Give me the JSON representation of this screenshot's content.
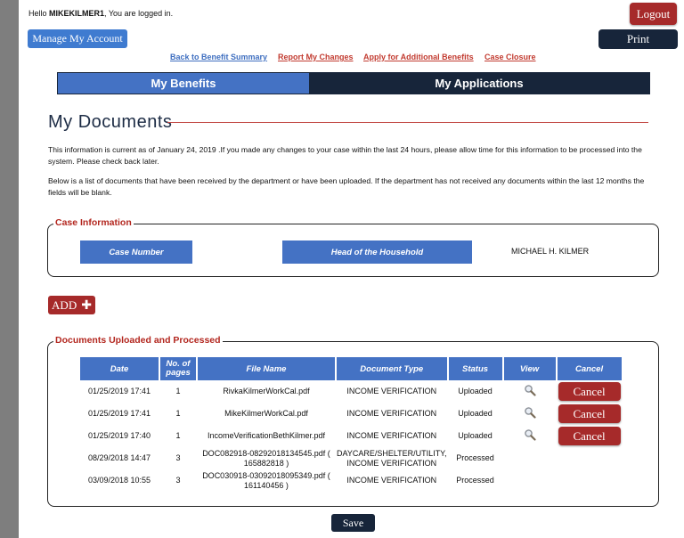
{
  "header": {
    "hello_prefix": "Hello ",
    "username": "MIKEKILMER1",
    "hello_suffix": ", You are logged in.",
    "logout_label": "Logout",
    "manage_account_label": "Manage My Account",
    "print_label": "Print"
  },
  "nav_links": [
    {
      "label": "Back to Benefit Summary",
      "color": "#3f6fc0"
    },
    {
      "label": "Report My Changes",
      "color": "#c23b30"
    },
    {
      "label": "Apply for Additional Benefits",
      "color": "#c23b30"
    },
    {
      "label": "Case Closure",
      "color": "#c23b30"
    }
  ],
  "tabs": [
    {
      "label": "My Benefits"
    },
    {
      "label": "My Applications"
    }
  ],
  "page_title": "My Documents",
  "info_paragraph_1": "This information is current as of January 24, 2019 .If you made any changes to your case within the last 24 hours, please allow time for this information to be processed into the system. Please check back later.",
  "info_paragraph_2": "Below is a list of documents that have been received by the department or have been uploaded. If the department has not received any documents within the last 12 months the fields will be blank.",
  "case_information": {
    "legend": "Case Information",
    "case_number_label": "Case Number",
    "head_of_household_label": "Head of the Household",
    "head_of_household_value": "MICHAEL H. KILMER"
  },
  "add_button_label": "ADD",
  "documents": {
    "legend": "Documents Uploaded and Processed",
    "columns": [
      "Date",
      "No. of pages",
      "File Name",
      "Document Type",
      "Status",
      "View",
      "Cancel"
    ],
    "rows": [
      {
        "date": "01/25/2019 17:41",
        "pages": "1",
        "file": "RivkaKilmerWorkCal.pdf",
        "type": "INCOME VERIFICATION",
        "status": "Uploaded",
        "viewable": true,
        "cancel": "Cancel"
      },
      {
        "date": "01/25/2019 17:41",
        "pages": "1",
        "file": "MikeKilmerWorkCal.pdf",
        "type": "INCOME VERIFICATION",
        "status": "Uploaded",
        "viewable": true,
        "cancel": "Cancel"
      },
      {
        "date": "01/25/2019 17:40",
        "pages": "1",
        "file": "IncomeVerificationBethKilmer.pdf",
        "type": "INCOME VERIFICATION",
        "status": "Uploaded",
        "viewable": true,
        "cancel": "Cancel"
      },
      {
        "date": "08/29/2018 14:47",
        "pages": "3",
        "file": "DOC082918-08292018134545.pdf ( 165882818 )",
        "type": "DAYCARE/SHELTER/UTILITY, INCOME VERIFICATION",
        "status": "Processed",
        "viewable": false,
        "cancel": ""
      },
      {
        "date": "03/09/2018 10:55",
        "pages": "3",
        "file": "DOC030918-03092018095349.pdf ( 161140456 )",
        "type": "INCOME VERIFICATION",
        "status": "Processed",
        "viewable": false,
        "cancel": ""
      }
    ]
  },
  "save_label": "Save",
  "colors": {
    "accent_blue": "#4472c4",
    "navy": "#17253a",
    "danger_red": "#a62a2a",
    "legend_red": "#b3271f"
  }
}
